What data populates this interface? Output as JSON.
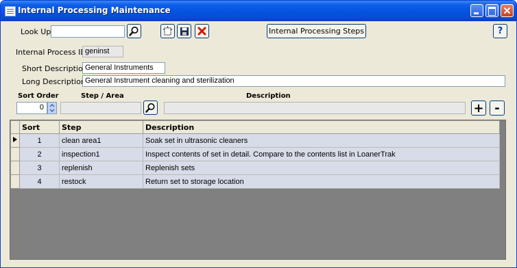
{
  "window": {
    "title": "Internal Processing Maintenance"
  },
  "toolbar": {
    "lookup_label": "Look Up",
    "lookup_value": "",
    "process_steps_label": "Internal Processing Steps",
    "help_label": "?"
  },
  "form": {
    "process_id_label": "Internal Process ID",
    "process_id_value": "geninst",
    "short_desc_label": "Short Description",
    "short_desc_value": "General Instruments",
    "long_desc_label": "Long Description",
    "long_desc_value": "General Instrument cleaning and sterilization"
  },
  "step_entry": {
    "sort_order_label": "Sort Order",
    "step_area_label": "Step / Area",
    "description_label": "Description",
    "sort_order_value": "0",
    "step_value": "",
    "description_value": "",
    "add_label": "+",
    "remove_label": "-"
  },
  "grid": {
    "columns": [
      "Sort",
      "Step",
      "Description"
    ],
    "rows": [
      {
        "sort": "1",
        "step": "clean area1",
        "description": "Soak set in ultrasonic cleaners",
        "current": true
      },
      {
        "sort": "2",
        "step": "inspection1",
        "description": "Inspect contents of set in detail. Compare to the contents list in LoanerTrak",
        "current": false
      },
      {
        "sort": "3",
        "step": "replenish",
        "description": "Replenish sets",
        "current": false
      },
      {
        "sort": "4",
        "step": "restock",
        "description": "Return set to storage location",
        "current": false
      }
    ]
  },
  "icons": {
    "app": "window-app-icon",
    "minimize": "minimize-icon",
    "maximize": "maximize-icon",
    "close": "close-icon",
    "lookup": "magnifier-icon",
    "new": "new-record-icon",
    "save": "floppy-save-icon",
    "delete": "red-x-delete-icon",
    "step_lookup": "magnifier-icon",
    "row_pointer": "row-pointer-icon",
    "spinner": "up-down-spinner-icon"
  },
  "colors": {
    "titlebar": "#0453df",
    "window_bg": "#ece9d8",
    "grid_row_bg": "#d8dce8",
    "grid_empty_bg": "#808080",
    "delete_red": "#cc1a00"
  }
}
